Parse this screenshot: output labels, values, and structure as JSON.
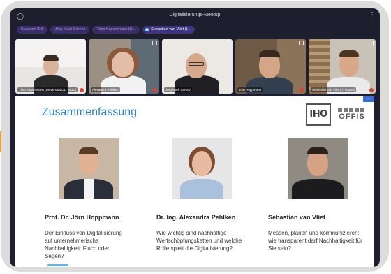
{
  "meeting": {
    "title": "Digitalisierungs-Meetup"
  },
  "chips": [
    {
      "label": "Susanne Boll",
      "active": false
    },
    {
      "label": "Jörg-Mark Gómez",
      "active": false
    },
    {
      "label": "Timo Kasselmann (U...",
      "active": false
    },
    {
      "label": "Sebastian van Vliet (I...",
      "active": true
    }
  ],
  "tiles": [
    {
      "name": "Timo Kasselmann (Universität OL, INUC)",
      "muted": true
    },
    {
      "name": "Alexandra Pehlken",
      "muted": true
    },
    {
      "name": "Jörg-Mark Gómez",
      "muted": false
    },
    {
      "name": "Jörn Hoppmann",
      "muted": true
    },
    {
      "name": "Sebastian van Vliet (IT Impuls)",
      "muted": true
    }
  ],
  "slide": {
    "heading": "Zusammenfassung",
    "logo_left": "IHO",
    "logo_right": "OFFIS",
    "speakers": [
      {
        "name": "Prof. Dr. Jörn Hoppmann",
        "topic": "Der Einfluss von Digitalisierung auf unternehmerische Nachhaltigkeit: Fluch oder Segen?"
      },
      {
        "name": "Dr. Ing. Alexandra Pehlken",
        "topic": "Wie wichtig sind nachhaltige Wertschöpfungsketten und welche Rolle spielt die Digitalisierung?"
      },
      {
        "name": "Sebastian van Vliet",
        "topic": "Messen, planen und kommunizieren: wie transparent darf Nachhaltigkeit für Sie sein?"
      }
    ]
  },
  "colors": {
    "accent": "#2f7fc1",
    "screen_bg": "#1d1f2e",
    "chip_bg": "#3b2e68"
  },
  "icons": {
    "user": "user-icon",
    "menu": "more-vertical-icon",
    "fullscreen": "fullscreen-icon",
    "mic_muted": "mic-muted-icon"
  }
}
